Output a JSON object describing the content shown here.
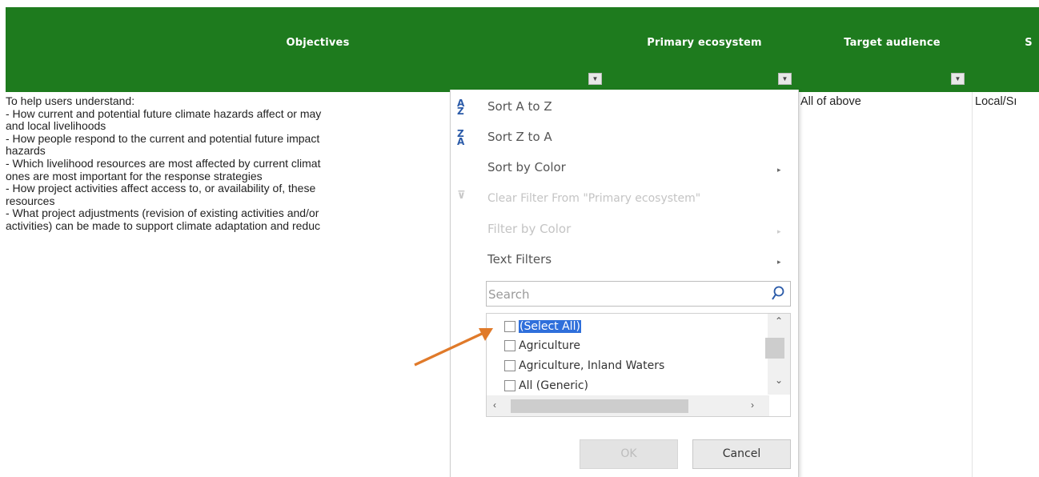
{
  "header": {
    "columns": [
      {
        "label": "Objectives"
      },
      {
        "label": "Primary ecosystem"
      },
      {
        "label": "Target audience"
      },
      {
        "label": "S"
      }
    ]
  },
  "row": {
    "objectives": "To help users understand:\n- How current and potential future climate hazards affect or may\nand local livelihoods\n- How people respond to the current and potential future impact\nhazards\n- Which livelihood resources are most affected by current climat\nones are most important for the response strategies\n- How project activities affect access to, or availability of, these\nresources\n- What project adjustments (revision of existing activities and/or\nactivities) can be made to support climate adaptation and reduc",
    "target_audience": "All of above",
    "scale": "Local/Sı"
  },
  "filter_menu": {
    "sort_a_z": "Sort A to Z",
    "sort_z_a": "Sort Z to A",
    "sort_by_color": "Sort by Color",
    "clear_filter": "Clear Filter From \"Primary ecosystem\"",
    "filter_by_color": "Filter by Color",
    "text_filters": "Text Filters",
    "search_placeholder": "Search",
    "items": [
      {
        "label": "(Select All)",
        "checked": false,
        "selected": true
      },
      {
        "label": "Agriculture",
        "checked": false
      },
      {
        "label": "Agriculture, Inland Waters",
        "checked": false
      },
      {
        "label": "All (Generic)",
        "checked": false
      }
    ],
    "ok_label": "OK",
    "cancel_label": "Cancel"
  },
  "colors": {
    "header_bg": "#1e7b1e",
    "selection": "#2f6fdb",
    "annotation_arrow": "#e07a2a"
  }
}
